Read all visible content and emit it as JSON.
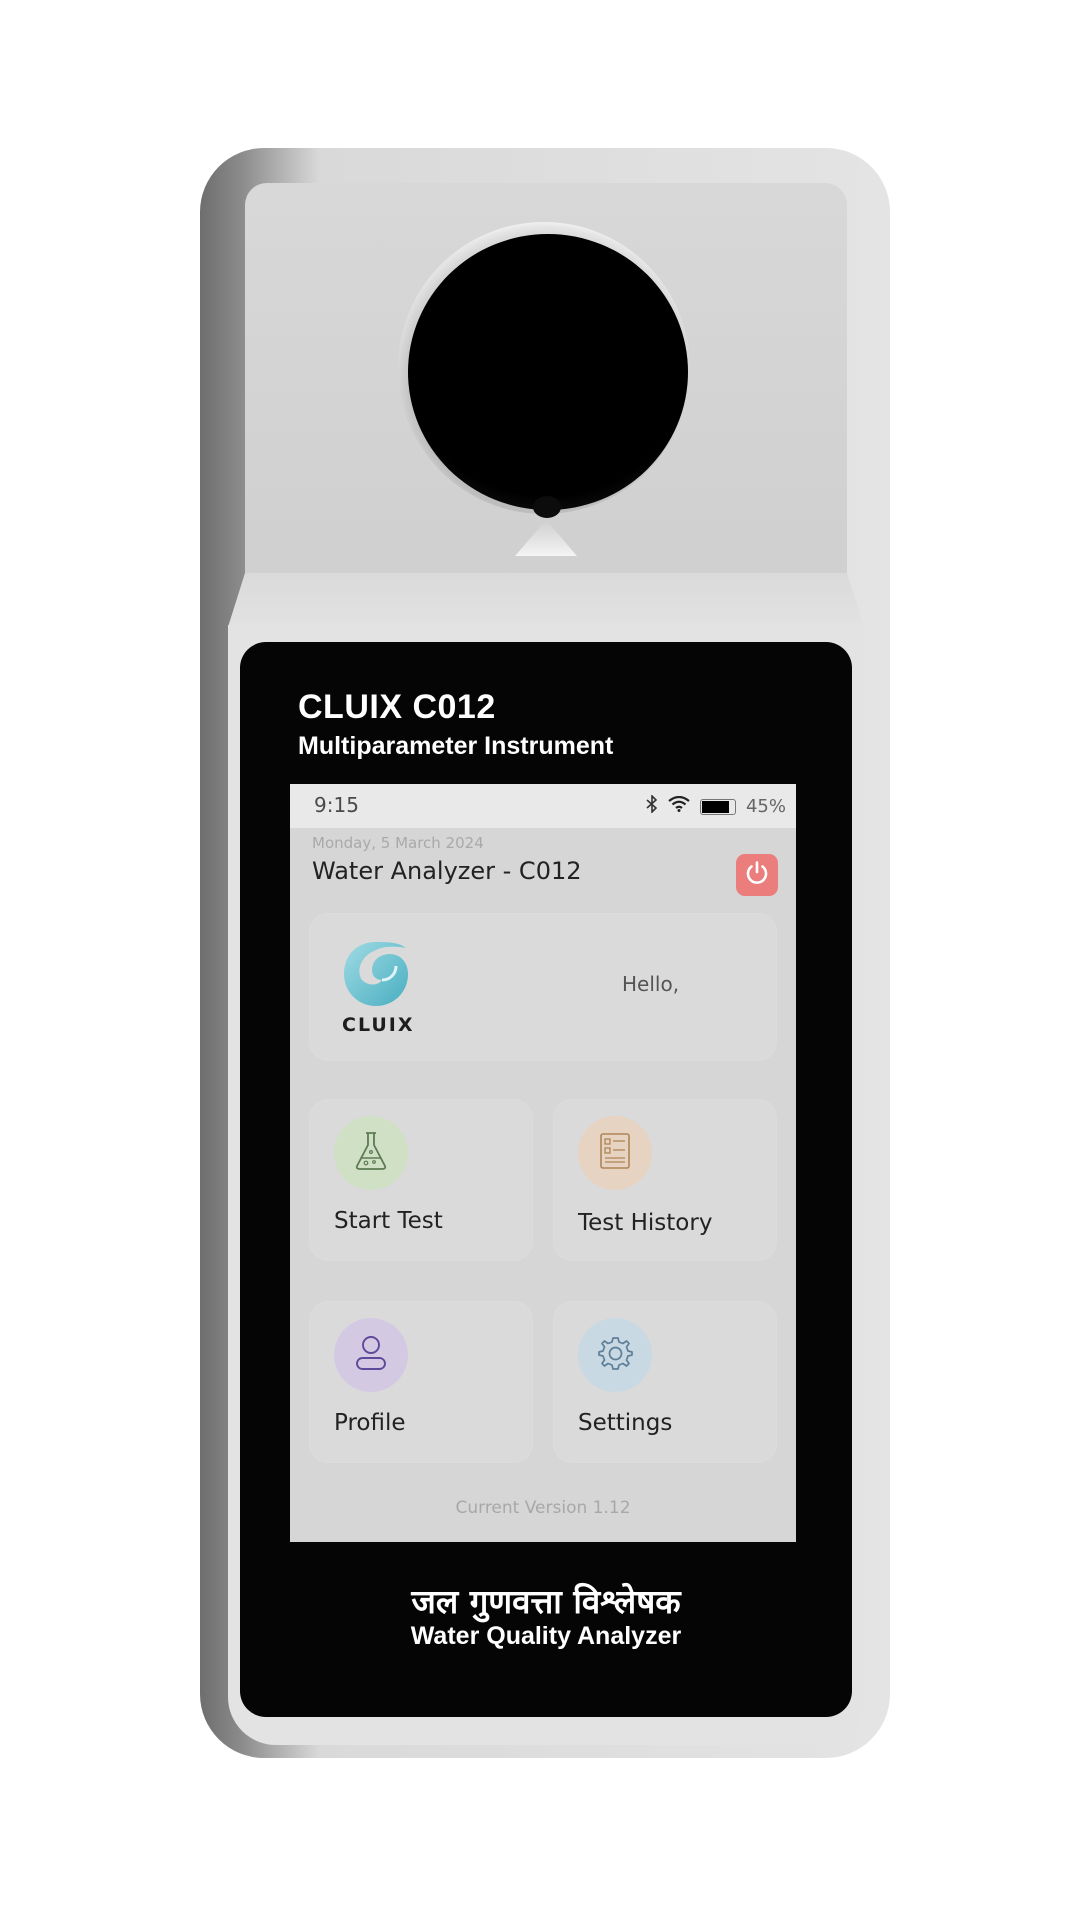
{
  "device": {
    "brand_title": "CLUIX C012",
    "brand_subtitle": "Multiparameter Instrument",
    "footer_hindi": "जल गुणवत्ता विश्लेषक",
    "footer_english": "Water Quality Analyzer"
  },
  "status_bar": {
    "time": "9:15",
    "icons": [
      "bluetooth-icon",
      "wifi-icon",
      "battery-icon"
    ],
    "battery_percent": "45%",
    "battery_level": 0.45
  },
  "header": {
    "date": "Monday, 5 March 2024",
    "title": "Water Analyzer - C012",
    "power_button_color": "#ec7d7d"
  },
  "welcome": {
    "logo_text": "CLUIX",
    "greeting": "Hello,"
  },
  "tiles": [
    {
      "label": "Start Test",
      "icon": "flask-icon",
      "color": "#cfe0c4"
    },
    {
      "label": "Test History",
      "icon": "document-list-icon",
      "color": "#e7d3c1"
    },
    {
      "label": "Profile",
      "icon": "user-icon",
      "color": "#d4c9e3"
    },
    {
      "label": "Settings",
      "icon": "gear-icon",
      "color": "#c8d9e3"
    }
  ],
  "footer": {
    "version": "Current Version 1.12"
  }
}
